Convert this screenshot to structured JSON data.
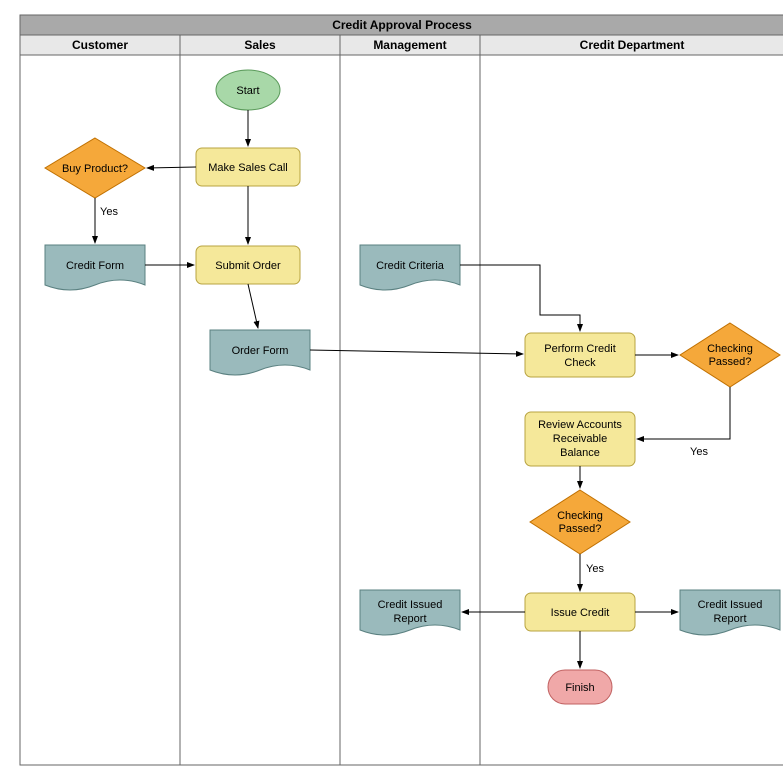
{
  "title": "Credit Approval Process",
  "lanes": {
    "customer": "Customer",
    "sales": "Sales",
    "management": "Management",
    "credit": "Credit Department"
  },
  "nodes": {
    "start": "Start",
    "makeSalesCall": "Make Sales Call",
    "buyProduct": "Buy Product?",
    "creditForm": "Credit Form",
    "submitOrder": "Submit Order",
    "orderForm": "Order Form",
    "creditCriteria": "Credit Criteria",
    "performCreditCheck_l1": "Perform Credit",
    "performCreditCheck_l2": "Check",
    "checkingPassed1_l1": "Checking",
    "checkingPassed1_l2": "Passed?",
    "reviewAR_l1": "Review Accounts",
    "reviewAR_l2": "Receivable",
    "reviewAR_l3": "Balance",
    "checkingPassed2_l1": "Checking",
    "checkingPassed2_l2": "Passed?",
    "issueCredit": "Issue Credit",
    "creditIssuedReport1_l1": "Credit Issued",
    "creditIssuedReport1_l2": "Report",
    "creditIssuedReport2_l1": "Credit Issued",
    "creditIssuedReport2_l2": "Report",
    "finish": "Finish"
  },
  "edgeLabels": {
    "yes1": "Yes",
    "yes2": "Yes",
    "yes3": "Yes"
  },
  "chart_data": {
    "type": "swimlane-flowchart",
    "title": "Credit Approval Process",
    "lanes": [
      "Customer",
      "Sales",
      "Management",
      "Credit Department"
    ],
    "nodes": [
      {
        "id": "start",
        "lane": "Sales",
        "type": "terminator",
        "label": "Start"
      },
      {
        "id": "makeSalesCall",
        "lane": "Sales",
        "type": "process",
        "label": "Make Sales Call"
      },
      {
        "id": "buyProduct",
        "lane": "Customer",
        "type": "decision",
        "label": "Buy Product?"
      },
      {
        "id": "creditForm",
        "lane": "Customer",
        "type": "document",
        "label": "Credit Form"
      },
      {
        "id": "submitOrder",
        "lane": "Sales",
        "type": "process",
        "label": "Submit Order"
      },
      {
        "id": "orderForm",
        "lane": "Sales",
        "type": "document",
        "label": "Order Form"
      },
      {
        "id": "creditCriteria",
        "lane": "Management",
        "type": "document",
        "label": "Credit Criteria"
      },
      {
        "id": "performCreditCheck",
        "lane": "Credit Department",
        "type": "process",
        "label": "Perform Credit Check"
      },
      {
        "id": "checkingPassed1",
        "lane": "Credit Department",
        "type": "decision",
        "label": "Checking Passed?"
      },
      {
        "id": "reviewAR",
        "lane": "Credit Department",
        "type": "process",
        "label": "Review Accounts Receivable Balance"
      },
      {
        "id": "checkingPassed2",
        "lane": "Credit Department",
        "type": "decision",
        "label": "Checking Passed?"
      },
      {
        "id": "issueCredit",
        "lane": "Credit Department",
        "type": "process",
        "label": "Issue Credit"
      },
      {
        "id": "creditIssuedReport1",
        "lane": "Management",
        "type": "document",
        "label": "Credit Issued Report"
      },
      {
        "id": "creditIssuedReport2",
        "lane": "Credit Department",
        "type": "document",
        "label": "Credit Issued Report"
      },
      {
        "id": "finish",
        "lane": "Credit Department",
        "type": "terminator",
        "label": "Finish"
      }
    ],
    "edges": [
      {
        "from": "start",
        "to": "makeSalesCall"
      },
      {
        "from": "makeSalesCall",
        "to": "buyProduct"
      },
      {
        "from": "makeSalesCall",
        "to": "submitOrder"
      },
      {
        "from": "buyProduct",
        "to": "creditForm",
        "label": "Yes"
      },
      {
        "from": "creditForm",
        "to": "submitOrder"
      },
      {
        "from": "submitOrder",
        "to": "orderForm"
      },
      {
        "from": "orderForm",
        "to": "performCreditCheck"
      },
      {
        "from": "creditCriteria",
        "to": "performCreditCheck"
      },
      {
        "from": "performCreditCheck",
        "to": "checkingPassed1"
      },
      {
        "from": "checkingPassed1",
        "to": "reviewAR",
        "label": "Yes"
      },
      {
        "from": "reviewAR",
        "to": "checkingPassed2"
      },
      {
        "from": "checkingPassed2",
        "to": "issueCredit",
        "label": "Yes"
      },
      {
        "from": "issueCredit",
        "to": "creditIssuedReport1"
      },
      {
        "from": "issueCredit",
        "to": "creditIssuedReport2"
      },
      {
        "from": "issueCredit",
        "to": "finish"
      }
    ]
  }
}
